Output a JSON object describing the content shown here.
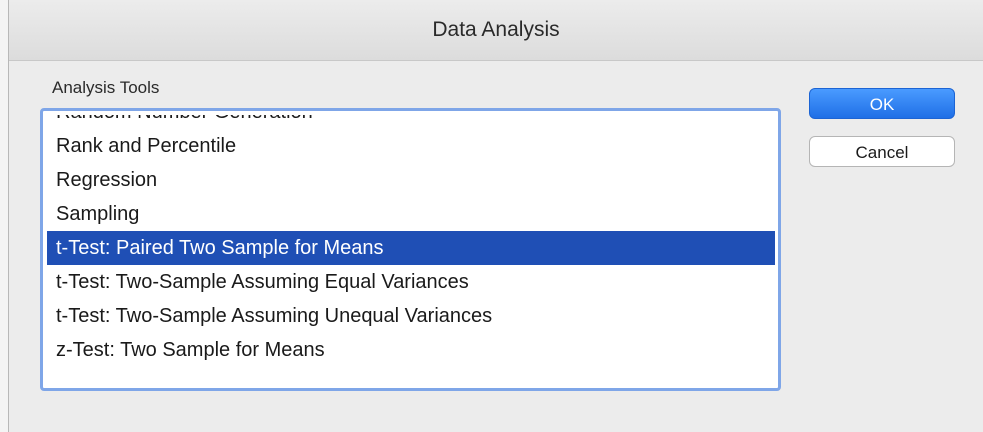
{
  "dialog": {
    "title": "Data Analysis",
    "group_label": "Analysis Tools",
    "tools": [
      "Random Number Generation",
      "Rank and Percentile",
      "Regression",
      "Sampling",
      "t-Test: Paired Two Sample for Means",
      "t-Test: Two-Sample Assuming Equal Variances",
      "t-Test: Two-Sample Assuming Unequal Variances",
      "z-Test: Two Sample for Means"
    ],
    "selected_tool": "t-Test: Paired Two Sample for Means",
    "ok_label": "OK",
    "cancel_label": "Cancel"
  },
  "colors": {
    "selection": "#1f4fb5",
    "focus_ring": "#7fa6e8",
    "default_button": "#1f6fe6"
  }
}
